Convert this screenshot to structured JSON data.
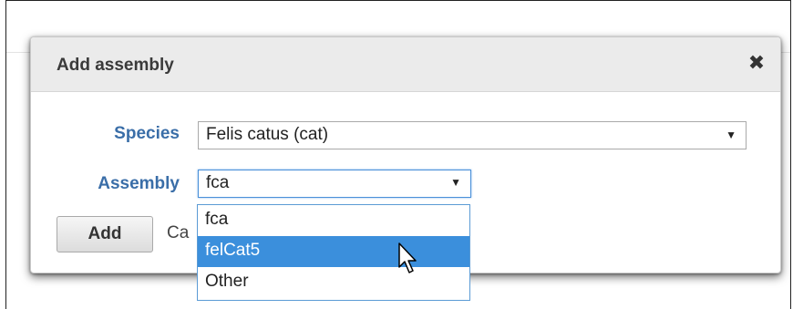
{
  "dialog": {
    "title": "Add assembly",
    "close_icon": "close-icon"
  },
  "form": {
    "species_label": "Species",
    "species_value": "Felis catus (cat)",
    "assembly_label": "Assembly",
    "assembly_value": "fca"
  },
  "actions": {
    "add_label": "Add",
    "cancel_label": "Ca"
  },
  "dropdown": {
    "options": [
      "fca",
      "felCat5",
      "Other"
    ],
    "highlighted": "felCat5"
  },
  "colors": {
    "label": "#3a6ea8",
    "highlight": "#3b8fdc",
    "header": "#ebebeb"
  }
}
